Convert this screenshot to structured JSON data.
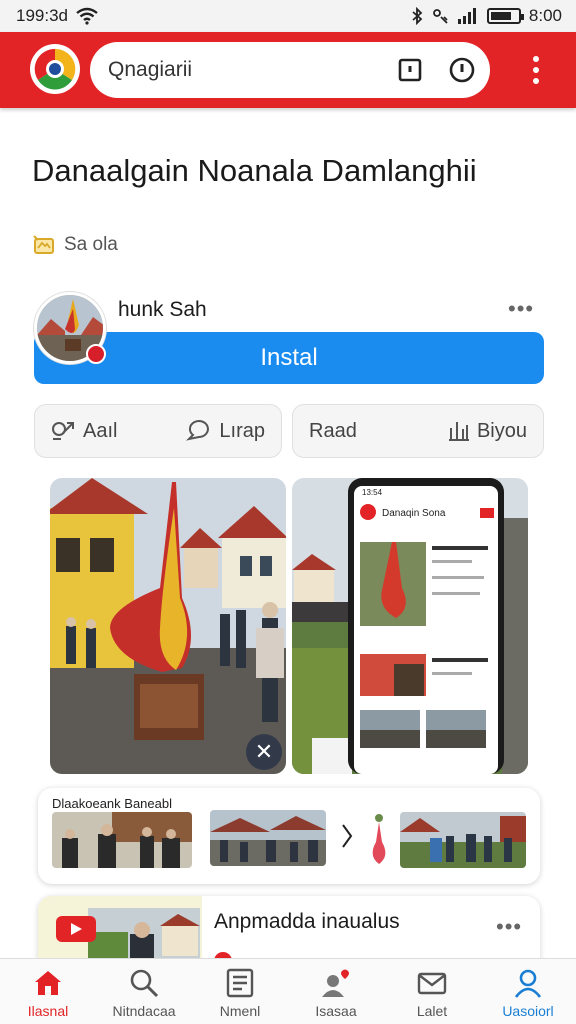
{
  "status_bar": {
    "time": "199:3d",
    "clock_right": "8:00",
    "battery_level": 0.75
  },
  "toolbar": {
    "search_value": "Qnagiarii"
  },
  "app": {
    "title": "Danaalgain Noanala Damlanghii",
    "category": "Sa ola",
    "developer": "hunk Sah",
    "install_label": "Instal"
  },
  "actions": {
    "left": [
      "Aaıl",
      "Lırap"
    ],
    "right": [
      "Raad",
      "Biyou"
    ]
  },
  "phone_mock": {
    "time": "13:54",
    "header": "Danaqin Sona"
  },
  "related": {
    "title": "Dlaakoeank Baneabl"
  },
  "card2": {
    "title": "Anpmadda inaualus"
  },
  "bottom_nav": {
    "items": [
      {
        "label": "Ilasnal",
        "icon": "home-icon"
      },
      {
        "label": "Nitndacaa",
        "icon": "search-icon"
      },
      {
        "label": "Nmenl",
        "icon": "list-icon"
      },
      {
        "label": "Isasaa",
        "icon": "user-heart-icon"
      },
      {
        "label": "Lalet",
        "icon": "mail-icon"
      },
      {
        "label": "Uasoiorl",
        "icon": "person-icon"
      }
    ]
  },
  "colors": {
    "accent_red": "#e32427",
    "install_blue": "#1a8cf0",
    "active_blue": "#1a7fd4"
  }
}
